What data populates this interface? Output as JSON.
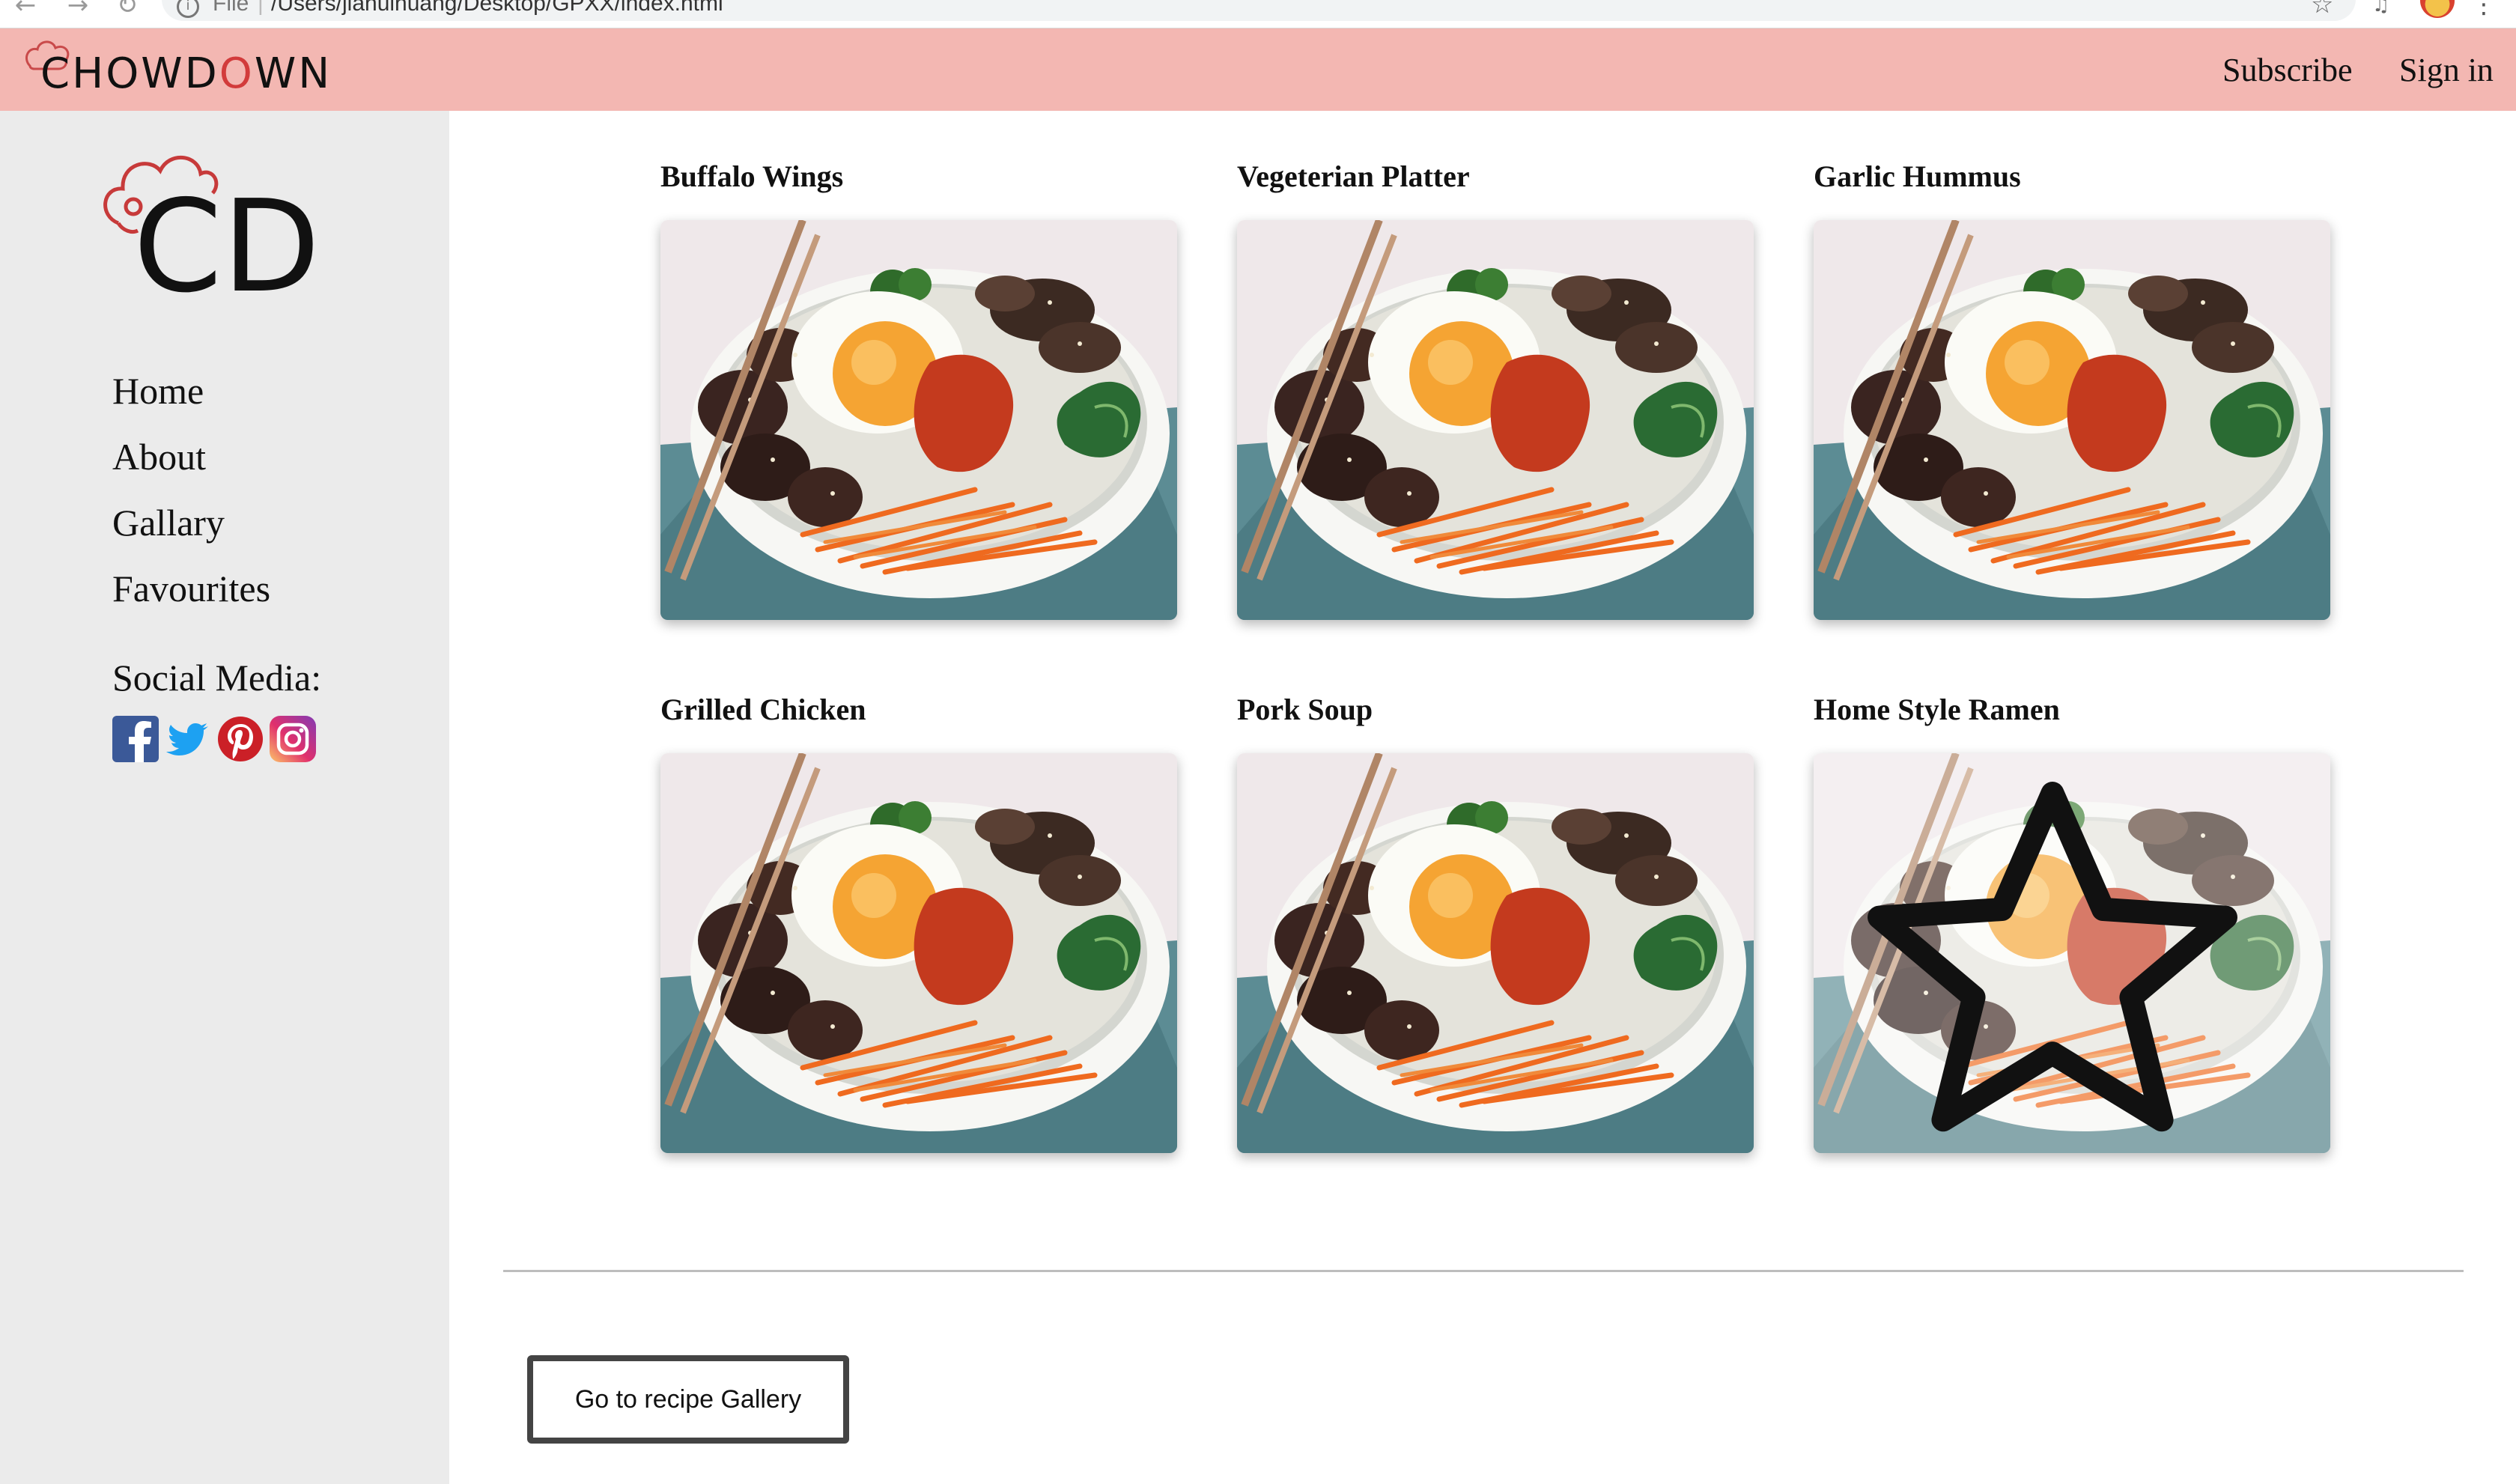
{
  "browser": {
    "back_icon": "arrow-left-icon",
    "forward_icon": "arrow-right-icon",
    "reload_icon": "reload-icon",
    "file_label": "File",
    "url": "/Users/jiahuihuang/Desktop/GPXX/index.html"
  },
  "header": {
    "brand_prefix": "CHOWD",
    "brand_accent": "O",
    "brand_suffix": "WN",
    "subscribe": "Subscribe",
    "sign_in": "Sign in",
    "background": "#f3b7b2",
    "accent_color": "#d23b3b"
  },
  "sidebar": {
    "logo_text": "CD",
    "nav": [
      {
        "label": "Home"
      },
      {
        "label": "About"
      },
      {
        "label": "Gallary"
      },
      {
        "label": "Favourites"
      }
    ],
    "social_title": "Social Media:",
    "social": [
      "facebook-icon",
      "twitter-icon",
      "pinterest-icon",
      "instagram-icon"
    ]
  },
  "recipes": [
    {
      "title": "Buffalo Wings"
    },
    {
      "title": "Vegeterian Platter"
    },
    {
      "title": "Garlic Hummus"
    },
    {
      "title": "Grilled Chicken"
    },
    {
      "title": "Pork Soup"
    },
    {
      "title": "Home Style Ramen",
      "hovered": true,
      "favourite_icon": "star-outline-icon"
    }
  ],
  "gallery_button": "Go to recipe Gallery"
}
